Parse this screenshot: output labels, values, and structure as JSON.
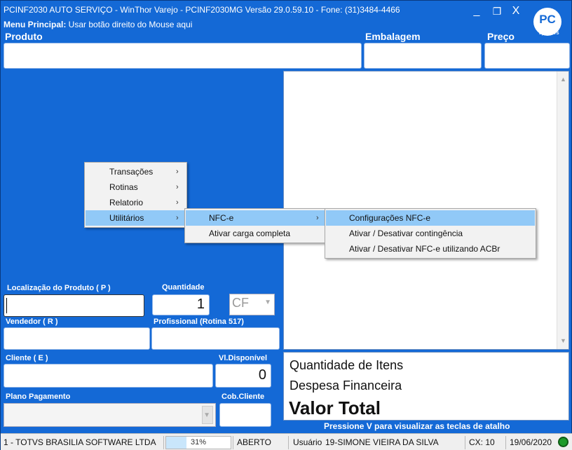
{
  "window": {
    "title": "PCINF2030 AUTO SERVIÇO - WinThor Varejo -  PCINF2030MG  Versão 29.0.59.10 - Fone: (31)3484-4466",
    "menu_hint_bold": "Menu Principal:",
    "menu_hint_text": " Usar botão direito do Mouse aqui",
    "minimize": "_",
    "restore": "❐",
    "close": "X",
    "logo_text": "PC",
    "logo_sub": "by TOTVS"
  },
  "header": {
    "produto_label": "Produto",
    "embalagem_label": "Embalagem",
    "preco_label": "Preço"
  },
  "form": {
    "localizacao_label": "Localização do Produto ( P )",
    "quantidade_label": "Quantidade",
    "quantidade_value": "1",
    "cf_value": "CF",
    "vendedor_label": "Vendedor ( R )",
    "profissional_label": "Profissional (Rotina 517)",
    "cliente_label": "Cliente ( E )",
    "vl_disponivel_label": "Vl.Disponível",
    "vl_disponivel_value": "0",
    "plano_label": "Plano Pagamento",
    "cob_label": "Cob.Cliente"
  },
  "totals": {
    "quantidade_itens": "Quantidade de Itens",
    "despesa_financeira": "Despesa Financeira",
    "valor_total": "Valor Total",
    "shortcut_hint": "Pressione V para visualizar as teclas de atalho"
  },
  "context_menu": {
    "items": [
      {
        "label": "Transações",
        "has_submenu": true,
        "highlighted": false
      },
      {
        "label": "Rotinas",
        "has_submenu": true,
        "highlighted": false
      },
      {
        "label": "Relatorio",
        "has_submenu": true,
        "highlighted": false
      },
      {
        "label": "Utilitários",
        "has_submenu": true,
        "highlighted": true
      }
    ],
    "submenu": [
      {
        "label": "NFC-e",
        "has_submenu": true,
        "highlighted": true
      },
      {
        "label": "Ativar carga completa",
        "has_submenu": false,
        "highlighted": false
      }
    ],
    "subsubmenu": [
      {
        "label": "Configurações NFC-e",
        "highlighted": true
      },
      {
        "label": "Ativar / Desativar contingência",
        "highlighted": false
      },
      {
        "label": "Ativar / Desativar NFC-e utilizando ACBr",
        "highlighted": false
      }
    ]
  },
  "statusbar": {
    "company": "1 - TOTVS BRASILIA SOFTWARE LTDA",
    "progress_text": "31%",
    "progress_fraction": 0.31,
    "state": "ABERTO",
    "user_label": "Usuário",
    "user": "19-SIMONE VIEIRA DA SILVA",
    "cx": "CX: 10",
    "date": "19/06/2020"
  },
  "colors": {
    "background": "#1469d6",
    "menu_highlight": "#91c9f7",
    "status_ok": "#1d9b2a"
  }
}
